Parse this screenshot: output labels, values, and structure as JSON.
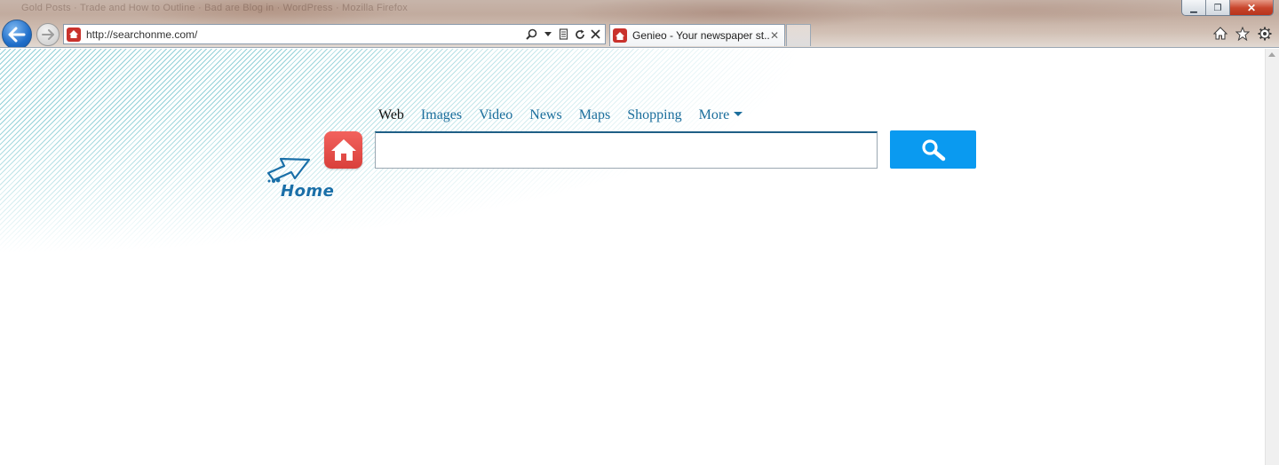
{
  "window": {
    "background_title": "Gold Posts · Trade and How to Outline · Bad are Blog in · WordPress · Mozilla Firefox",
    "controls": {
      "minimize_label": "▁",
      "restore_label": "❐",
      "close_label": "✕"
    }
  },
  "toolbar": {
    "back_icon": "back-arrow-icon",
    "forward_icon": "forward-arrow-icon",
    "address": {
      "url": "http://searchonme.com/",
      "favicon": "home-favicon-icon",
      "tools": [
        "search-icon",
        "dropdown-icon",
        "compatibility-icon",
        "refresh-icon",
        "stop-icon"
      ]
    },
    "tab": {
      "title": "Genieo - Your newspaper st...",
      "close_label": "✕"
    },
    "right_icons": [
      "home-icon",
      "favorites-star-icon",
      "settings-gear-icon"
    ]
  },
  "page": {
    "logo_text": "Home",
    "search_tabs": [
      {
        "label": "Web",
        "active": true
      },
      {
        "label": "Images",
        "active": false
      },
      {
        "label": "Video",
        "active": false
      },
      {
        "label": "News",
        "active": false
      },
      {
        "label": "Maps",
        "active": false
      },
      {
        "label": "Shopping",
        "active": false
      },
      {
        "label": "More",
        "active": false
      }
    ],
    "search": {
      "value": "",
      "placeholder": ""
    },
    "search_button_icon": "magnifier-icon"
  },
  "colors": {
    "accent": "#0a9af0",
    "link": "#1b6e9c",
    "home_badge": "#e4504b",
    "stripe": "#8ecfd6"
  }
}
